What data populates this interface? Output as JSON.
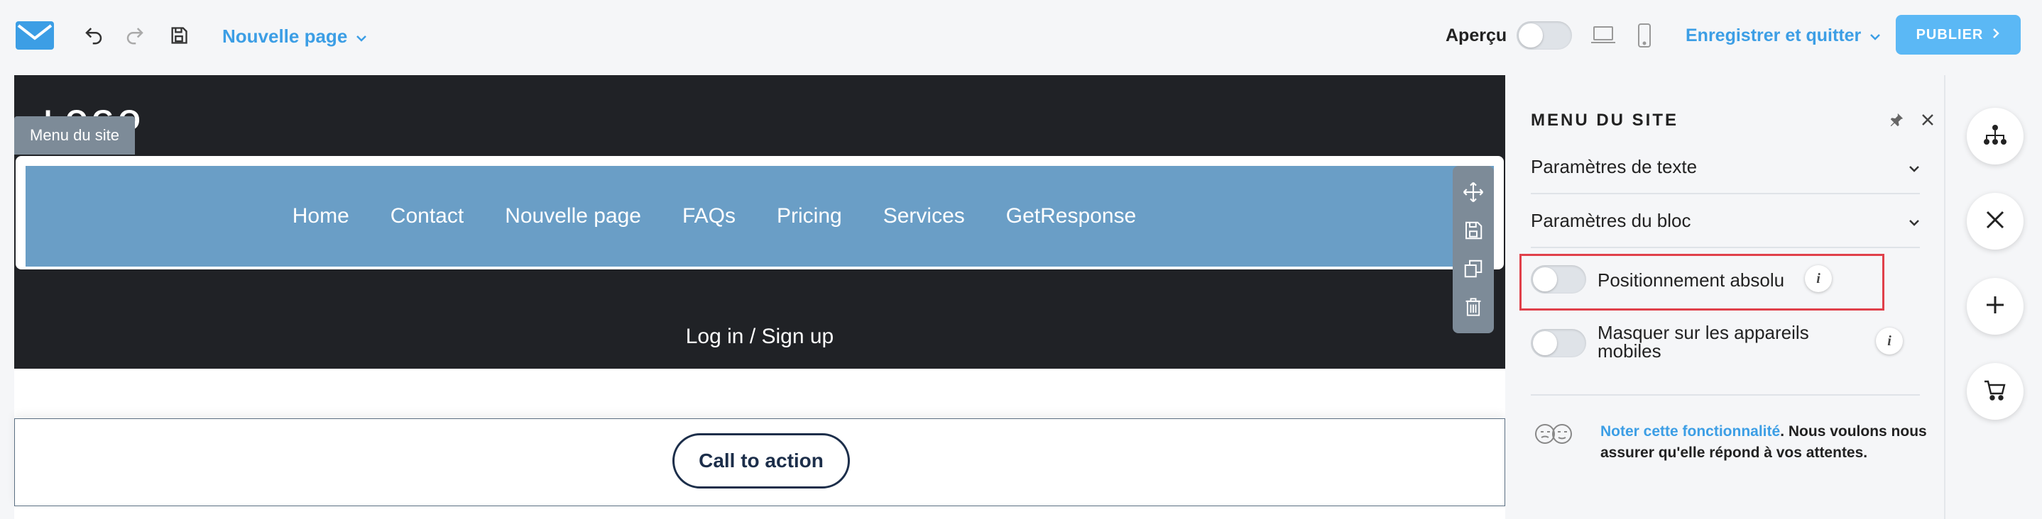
{
  "toolbar": {
    "page_name": "Nouvelle page",
    "preview_label": "Aperçu",
    "save_quit_label": "Enregistrer et quitter",
    "publish_label": "PUBLIER"
  },
  "canvas": {
    "logo_text": "LOGO",
    "menu_tag": "Menu du site",
    "menu_items": [
      "Home",
      "Contact",
      "Nouvelle page",
      "FAQs",
      "Pricing",
      "Services",
      "GetResponse"
    ],
    "login_text": "Log in / Sign up",
    "cta_label": "Call to action"
  },
  "panel": {
    "title": "MENU DU SITE",
    "sections": [
      "Paramètres de texte",
      "Paramètres du bloc"
    ],
    "absolute_label": "Positionnement absolu",
    "hide_mobile_label": "Masquer sur les appareils mobiles",
    "rate_link": "Noter cette fonctionnalité",
    "rate_text": ". Nous voulons nous assurer qu'elle répond à vos attentes."
  },
  "colors": {
    "accent": "#3c9ee5",
    "publish": "#5bb8f5",
    "menu_bar": "#6a9ec6",
    "dark_bg": "#202226",
    "highlight": "#e0404a"
  }
}
